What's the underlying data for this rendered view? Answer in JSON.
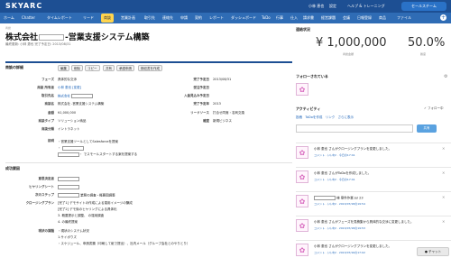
{
  "brand": {
    "logo": "SKYARC"
  },
  "header": {
    "user": "小林 恵也",
    "setup": "設定",
    "help": "ヘルプ & トレーニング",
    "app_switch": "セールスチーム"
  },
  "nav": {
    "tabs": [
      "ホーム",
      "Chatter",
      "タイムレポート",
      "リード",
      "商談",
      "営業計画",
      "取引先",
      "連絡先",
      "申請",
      "契約",
      "レポート",
      "ダッシュボード",
      "ToDo",
      "行事",
      "仕入",
      "請求書",
      "経営課題",
      "会議",
      "日報登録",
      "商品",
      "ファイル"
    ],
    "active": "商談"
  },
  "breadcrumb": "商談",
  "title": {
    "prefix": "株式会社",
    "suffix": "-営業支援システム構築"
  },
  "subtitle": "最終更新: 小林 恵也 完了予定日: 2013/08/31",
  "details": {
    "header": "商談の詳細",
    "buttons": [
      "編集",
      "削除",
      "コピー",
      "共有",
      "承認申請",
      "検収書を作成"
    ],
    "left": [
      {
        "label": "フェーズ",
        "value": "具体的な交渉"
      },
      {
        "label": "商談 所有者",
        "value": "小林 恵也 [変更]"
      },
      {
        "label": "取引先名",
        "value": "株式会社"
      },
      {
        "label": "商談名",
        "value": "株式会社 -営業支援システム構築"
      },
      {
        "label": "金額",
        "value": "¥1,000,000"
      },
      {
        "label": "商談タイプ",
        "value": "ソリューション納品"
      },
      {
        "label": "商談分類",
        "value": "イントラネット"
      }
    ],
    "right": [
      {
        "label": "完了予定日",
        "value": "2013/08/31"
      },
      {
        "label": "受注予定日",
        "value": ""
      },
      {
        "label": "入金見込み予定日",
        "value": ""
      },
      {
        "label": "完了予定年",
        "value": "2013"
      },
      {
        "label": "リードソース",
        "value": "打合せ同席・名刺交換"
      },
      {
        "label": "確度",
        "value": "新規ビジネス"
      }
    ],
    "description_label": "説明",
    "description": [
      "・営業支援ツールとしてSalesforceを提案",
      "・ ",
      "・ でスモールスタートする案を提案する"
    ]
  },
  "section2": {
    "header": "成功要因",
    "rows": [
      {
        "label": "意思決定者",
        "value": ""
      },
      {
        "label": "ヒヤリングシート",
        "value": ""
      },
      {
        "label": "次のステップ",
        "value": "業務の調査・概要図調整"
      },
      {
        "label": "クロージングプラン",
        "value": "[完了1] デモサイトの作成による運用イメージの醸成"
      },
      {
        "label": "",
        "value": "[完了2] デモ後のヒヤリングによる具体化"
      },
      {
        "label": "",
        "value": "3. 概要提示と調整、 の運用調査"
      },
      {
        "label": "",
        "value": "4. の最終提案"
      },
      {
        "label": "現状の課題",
        "value": "・現状のシステム状況"
      },
      {
        "label": "",
        "value": "1.サイボウズ"
      },
      {
        "label": "",
        "value": "・スケジュール、申請書類（印刷して紙で提出）、社内メール（グループ会社とのやりとり）"
      }
    ]
  },
  "stats": {
    "header": "連結状況",
    "amount": "¥ 1,000,000",
    "amount_label": "商談金額",
    "probability": "50.0%",
    "probability_label": "確度"
  },
  "followers": {
    "header": "フォローされている"
  },
  "activity": {
    "header": "アクティビティ",
    "follow_label": "フォロー中",
    "tabs": [
      "投稿",
      "ToDo",
      "を作成",
      "リンク",
      "さらに表示"
    ],
    "post_button": "共有",
    "feed": [
      {
        "text": "小林 恵也 さんがクロージングプランを変更しました。",
        "meta": "コメント · いいね! · 今日の17:41"
      },
      {
        "text": "小林 恵也 さんがToDoを作成しました。",
        "meta": "コメント · いいね! · 今日の17:41"
      },
      {
        "text": "様 案件作業 Jul 23",
        "meta": "コメント · いいね! · 2013/07/18の19:54"
      },
      {
        "text": "小林 恵也 さんがフェーズを見積集から具体的な交渉に変更しました。",
        "meta": "コメント · いいね! · 2013/07/18の19:53"
      },
      {
        "text": "小林 恵也 さんがクロージングプランを変更しました。",
        "meta": "コメント · いいね! · 2013/07/16の17:02"
      }
    ]
  },
  "chat": {
    "label": "チャット"
  }
}
